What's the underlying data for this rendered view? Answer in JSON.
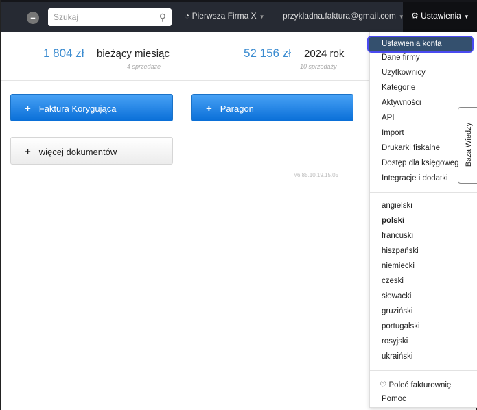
{
  "nav": {
    "search_placeholder": "Szukaj",
    "company": "Pierwsza Firma X",
    "email": "przykladna.faktura@gmail.com",
    "settings": "Ustawienia"
  },
  "stats": [
    {
      "amount": "1 804 zł",
      "label": "bieżący miesiąc",
      "sub": "4 sprzedaże"
    },
    {
      "amount": "52 156 zł",
      "label": "2024 rok",
      "sub": "10 sprzedaży"
    }
  ],
  "buttons": {
    "correction": "Faktura Korygująca",
    "receipt": "Paragon",
    "more": "więcej dokumentów"
  },
  "version": "v6.85.10.19.15.05",
  "menu": {
    "active": "Ustawienia konta",
    "items": [
      "Dane firmy",
      "Użytkownicy",
      "Kategorie",
      "Aktywności",
      "API",
      "Import",
      "Drukarki fiskalne",
      "Dostęp dla księgowego",
      "Integracje i dodatki"
    ],
    "languages": [
      "angielski",
      "polski",
      "francuski",
      "hiszpański",
      "niemiecki",
      "czeski",
      "słowacki",
      "gruziński",
      "portugalski",
      "rosyjski",
      "ukraiński"
    ],
    "selected_language": "polski",
    "recommend": "Poleć fakturownię",
    "help": "Pomoc"
  },
  "knowledge_base": "Baza Wiedzy"
}
